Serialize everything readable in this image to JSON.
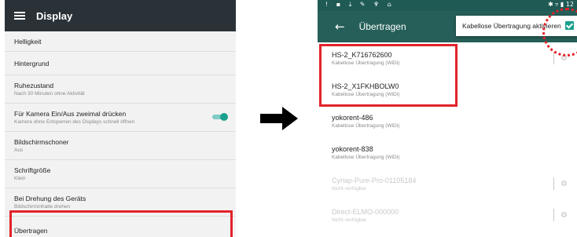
{
  "left": {
    "appbar": {
      "menu_icon": "hamburger-menu-icon",
      "title": "Display"
    },
    "items": [
      {
        "title": "Helligkeit",
        "subtitle": ""
      },
      {
        "title": "Hintergrund",
        "subtitle": ""
      },
      {
        "title": "Ruhezustand",
        "subtitle": "Nach 30 Minuten ohne Aktivität"
      },
      {
        "title": "Für Kamera Ein/Aus zweimal drücken",
        "subtitle": "Kamera ohne Entsperren des Displays schnell öffnen",
        "toggle": "on"
      },
      {
        "title": "Bildschirmschoner",
        "subtitle": "Aus"
      },
      {
        "title": "Schriftgröße",
        "subtitle": "Klein"
      },
      {
        "title": "Bei Drehung des Geräts",
        "subtitle": "Bildschirminhalte drehen"
      },
      {
        "title": "Übertragen",
        "subtitle": ""
      }
    ]
  },
  "right": {
    "toolbar": {
      "back_icon": "back-arrow-icon",
      "title": "Übertragen"
    },
    "popup": {
      "label": "Kabellose Übertragung aktivieren",
      "checked": true
    },
    "devices": [
      {
        "name": "HS-2_K716762600",
        "status": "Kabellose Übertragung (WiDi)",
        "available": true
      },
      {
        "name": "HS-2_X1FKHBOLW0",
        "status": "Kabellose Übertragung (WiDi)",
        "available": true
      },
      {
        "name": "yokorent-486",
        "status": "Kabellose Übertragung (WiDi)",
        "available": true
      },
      {
        "name": "yokorent-838",
        "status": "Kabellose Übertragung (WiDi)",
        "available": true
      },
      {
        "name": "Cyriap-Pure-Pro-01105184",
        "status": "Nicht verfügbar",
        "available": false
      },
      {
        "name": "Direct-ELMO-000000",
        "status": "Nicht verfügbar",
        "available": false
      }
    ]
  },
  "colors": {
    "left_appbar": "#2b3237",
    "right_toolbar": "#265f59",
    "accent": "#1aa08d",
    "highlight": "#e3222a"
  }
}
